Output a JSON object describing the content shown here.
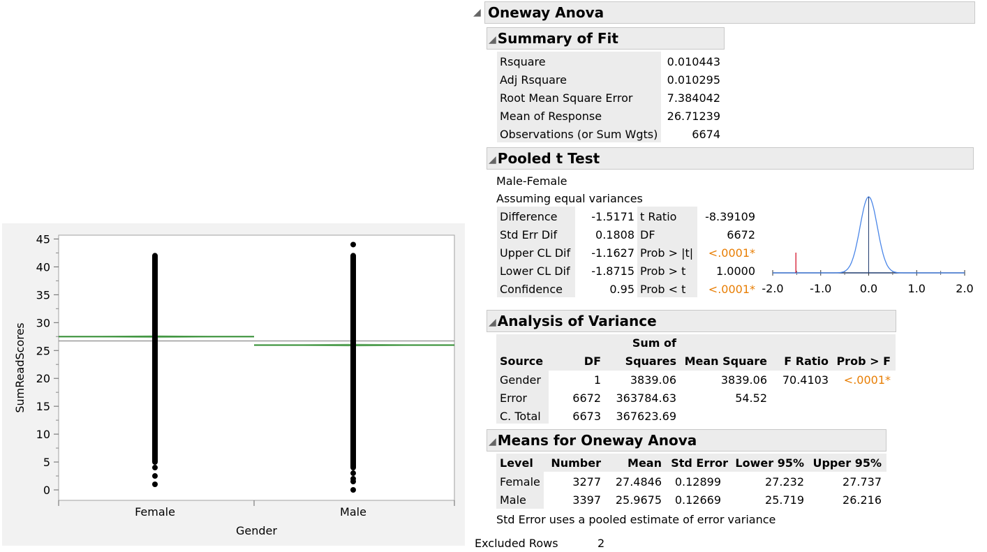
{
  "chart_data": {
    "type": "scatter",
    "title": "",
    "xlabel": "Gender",
    "ylabel": "SumReadScores",
    "categories": [
      "Female",
      "Male"
    ],
    "ylim": [
      -2,
      47
    ],
    "yticks": [
      0,
      5,
      10,
      15,
      20,
      25,
      30,
      35,
      40,
      45
    ],
    "grand_mean": 26.71239,
    "means": [
      27.4846,
      25.9675
    ],
    "ci_lower": [
      27.232,
      25.719
    ],
    "ci_upper": [
      27.737,
      26.216
    ],
    "points": {
      "Female": {
        "column_from": 5,
        "column_to": 42,
        "extra": [
          4,
          2.5,
          1
        ]
      },
      "Male": {
        "column_from": 4,
        "column_to": 42,
        "extra": [
          44,
          3,
          2,
          1.5,
          0
        ]
      }
    },
    "colors": {
      "mean_line": "#2e8b2e",
      "grand_mean_line": "#808080",
      "points": "#000000"
    }
  },
  "oneway": {
    "title": "Oneway Anova",
    "summary": {
      "title": "Summary of Fit",
      "rows": [
        {
          "label": "Rsquare",
          "value": "0.010443"
        },
        {
          "label": "Adj Rsquare",
          "value": "0.010295"
        },
        {
          "label": "Root Mean Square Error",
          "value": "7.384042"
        },
        {
          "label": "Mean of Response",
          "value": "26.71239"
        },
        {
          "label": "Observations (or Sum Wgts)",
          "value": "6674"
        }
      ]
    },
    "ttest": {
      "title": "Pooled t Test",
      "line1": "Male-Female",
      "line2": "Assuming equal variances",
      "left": [
        {
          "label": "Difference",
          "value": "-1.5171"
        },
        {
          "label": "Std Err Dif",
          "value": "0.1808"
        },
        {
          "label": "Upper CL Dif",
          "value": "-1.1627"
        },
        {
          "label": "Lower CL Dif",
          "value": "-1.8715"
        },
        {
          "label": "Confidence",
          "value": "0.95"
        }
      ],
      "right": [
        {
          "label": "t Ratio",
          "value": "-8.39109"
        },
        {
          "label": "DF",
          "value": "6672"
        },
        {
          "label": "Prob > |t|",
          "value": "<.0001*"
        },
        {
          "label": "Prob > t",
          "value": "1.0000"
        },
        {
          "label": "Prob < t",
          "value": "<.0001*"
        }
      ],
      "axis_ticks": [
        "-2.0",
        "-1.0",
        "0.0",
        "1.0",
        "2.0"
      ],
      "marker_value": -1.5171
    },
    "anova": {
      "title": "Analysis of Variance",
      "headers": {
        "source": "Source",
        "df": "DF",
        "ss_top": "Sum of",
        "ss": "Squares",
        "ms": "Mean Square",
        "f": "F Ratio",
        "p": "Prob > F"
      },
      "rows": [
        {
          "source": "Gender",
          "df": "1",
          "ss": "3839.06",
          "ms": "3839.06",
          "f": "70.4103",
          "p": "<.0001*"
        },
        {
          "source": "Error",
          "df": "6672",
          "ss": "363784.63",
          "ms": "54.52",
          "f": "",
          "p": ""
        },
        {
          "source": "C. Total",
          "df": "6673",
          "ss": "367623.69",
          "ms": "",
          "f": "",
          "p": ""
        }
      ]
    },
    "means": {
      "title": "Means for Oneway Anova",
      "headers": {
        "level": "Level",
        "number": "Number",
        "mean": "Mean",
        "se": "Std Error",
        "lo": "Lower 95%",
        "hi": "Upper 95%"
      },
      "rows": [
        {
          "level": "Female",
          "number": "3277",
          "mean": "27.4846",
          "se": "0.12899",
          "lo": "27.232",
          "hi": "27.737"
        },
        {
          "level": "Male",
          "number": "3397",
          "mean": "25.9675",
          "se": "0.12669",
          "lo": "25.719",
          "hi": "26.216"
        }
      ],
      "note": "Std Error uses a pooled estimate of error variance"
    },
    "excluded_label": "Excluded Rows",
    "excluded_value": "2"
  }
}
